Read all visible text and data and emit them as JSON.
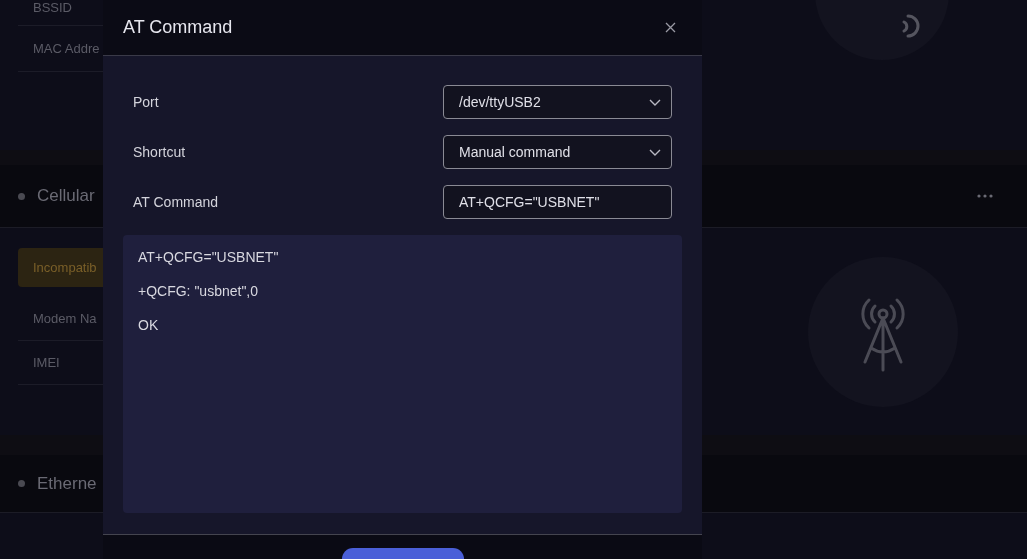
{
  "background": {
    "wifi_rows": [
      {
        "label": "BSSID"
      },
      {
        "label": "MAC Addre"
      }
    ],
    "cellular": {
      "title": "Cellular",
      "badge": "Incompatib",
      "rows": [
        {
          "label": "Modem Na"
        },
        {
          "label": "IMEI"
        }
      ]
    },
    "ethernet": {
      "title": "Etherne"
    }
  },
  "modal": {
    "title": "AT Command",
    "fields": [
      {
        "label": "Port",
        "kind": "select",
        "value": "/dev/ttyUSB2"
      },
      {
        "label": "Shortcut",
        "kind": "select",
        "value": "Manual command"
      },
      {
        "label": "AT Command",
        "kind": "input",
        "value": "AT+QCFG=\"USBNET\""
      }
    ],
    "output": [
      "AT+QCFG=\"USBNET\"",
      "+QCFG: \"usbnet\",0",
      "OK"
    ]
  }
}
